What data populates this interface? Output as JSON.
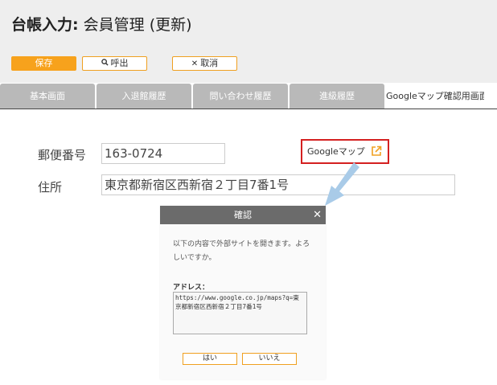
{
  "page": {
    "title_bold": "台帳入力:",
    "title_rest": " 会員管理 (更新)"
  },
  "toolbar": {
    "save_label": "保存",
    "call_label": "呼出",
    "cancel_label": "取消"
  },
  "tabs": [
    {
      "label": "基本画面",
      "active": false
    },
    {
      "label": "入退館履歴",
      "active": false
    },
    {
      "label": "問い合わせ履歴",
      "active": false
    },
    {
      "label": "進級履歴",
      "active": false
    },
    {
      "label": "Googleマップ確認用画面",
      "active": true
    }
  ],
  "form": {
    "postal_label": "郵便番号",
    "postal_value": "163-0724",
    "address_label": "住所",
    "address_value": "東京都新宿区西新宿２丁目7番1号",
    "map_link_label": "Googleマップ"
  },
  "dialog": {
    "title": "確認",
    "close_symbol": "✕",
    "message": "以下の内容で外部サイトを開きます。よろしいですか。",
    "address_label": "アドレス：",
    "address_value": "https://www.google.co.jp/maps?q=東京都新宿区西新宿２丁目7番1号",
    "yes_label": "はい",
    "no_label": "いいえ"
  },
  "colors": {
    "accent": "#f7a21c",
    "highlight_border": "#d42020",
    "tab_inactive": "#b9b9b9",
    "dialog_header": "#6b6b6b",
    "arrow": "#a9cbe8"
  }
}
